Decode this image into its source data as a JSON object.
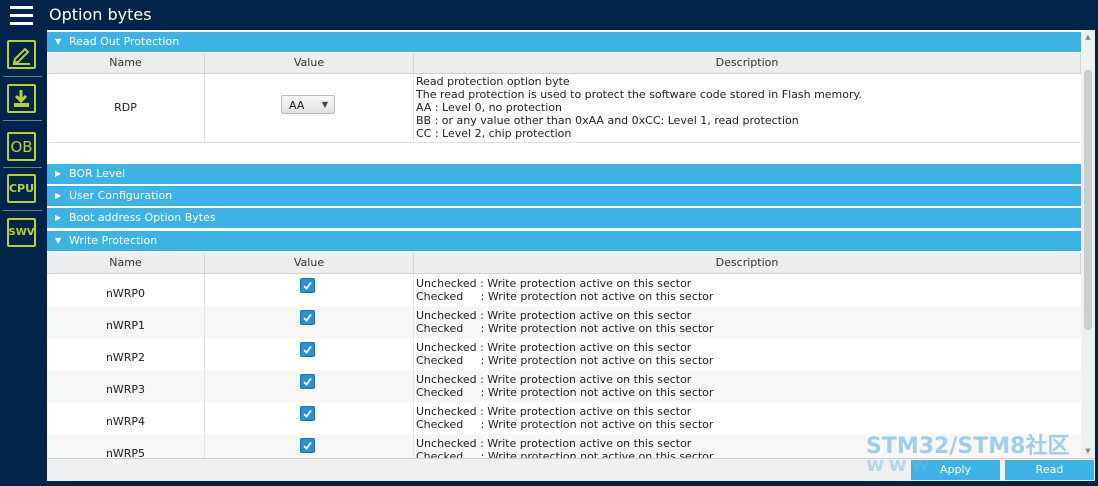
{
  "header": {
    "title": "Option bytes"
  },
  "sidebar": {
    "items": [
      {
        "icon": "edit-icon",
        "label": ""
      },
      {
        "icon": "download-icon",
        "label": ""
      },
      {
        "icon": "ob-icon",
        "label": "OB"
      },
      {
        "icon": "cpu-icon",
        "label": "CPU"
      },
      {
        "icon": "swv-icon",
        "label": "SWV"
      }
    ]
  },
  "columns": {
    "name": "Name",
    "value": "Value",
    "description": "Description"
  },
  "sections": {
    "read_out": {
      "label": "Read Out Protection",
      "expanded": true
    },
    "bor": {
      "label": "BOR Level",
      "expanded": false
    },
    "user_config": {
      "label": "User Configuration",
      "expanded": false
    },
    "boot_address": {
      "label": "Boot address Option Bytes",
      "expanded": false
    },
    "write_protection": {
      "label": "Write Protection",
      "expanded": true
    }
  },
  "rdp": {
    "name": "RDP",
    "value": "AA",
    "description": "Read protection option byte\nThe read protection is used to protect the software code stored in Flash memory.\nAA : Level 0, no protection\nBB : or any value other than 0xAA and 0xCC: Level 1, read protection\nCC : Level 2, chip protection"
  },
  "wrp": {
    "description": "Unchecked : Write protection active on this sector\nChecked     : Write protection not active on this sector",
    "rows": [
      {
        "name": "nWRP0",
        "checked": true
      },
      {
        "name": "nWRP1",
        "checked": true
      },
      {
        "name": "nWRP2",
        "checked": true
      },
      {
        "name": "nWRP3",
        "checked": true
      },
      {
        "name": "nWRP4",
        "checked": true
      },
      {
        "name": "nWRP5",
        "checked": true
      }
    ]
  },
  "actions": {
    "apply": "Apply",
    "read": "Read"
  },
  "watermark": {
    "line1": "STM32/STM8社区",
    "line2": "www"
  },
  "colors": {
    "background": "#03234b",
    "accent": "#3cb3e4",
    "sidebar_icon": "#b7d32c"
  }
}
